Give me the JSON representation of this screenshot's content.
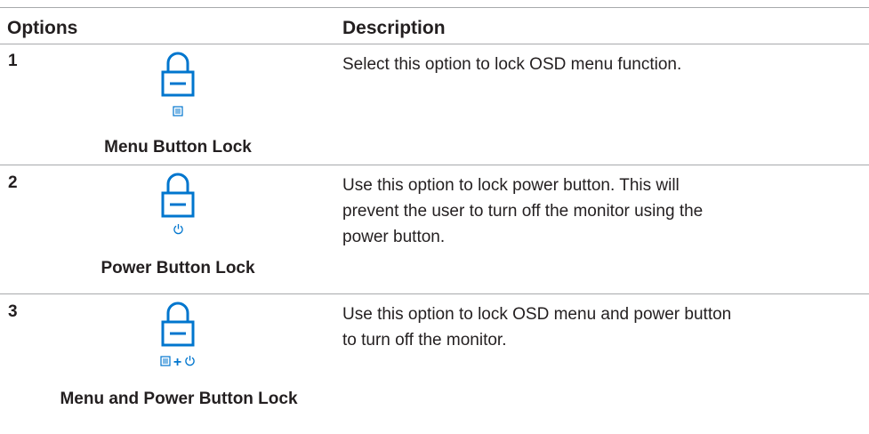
{
  "header": {
    "options": "Options",
    "description": "Description"
  },
  "rows": [
    {
      "number": "1",
      "label": "Menu Button Lock",
      "small_icons": [
        "menu-icon"
      ],
      "description": "Select this option to lock OSD menu function."
    },
    {
      "number": "2",
      "label": "Power Button Lock",
      "small_icons": [
        "power-icon"
      ],
      "description": "Use this option to lock power button. This will prevent the user to turn off the monitor using the power button."
    },
    {
      "number": "3",
      "label": "Menu and Power Button Lock",
      "small_icons": [
        "menu-icon",
        "plus",
        "power-icon"
      ],
      "plus": "+",
      "description": "Use this option to lock OSD menu and power button to turn off the monitor."
    }
  ],
  "colors": {
    "icon_blue": "#0076ce",
    "rule_gray": "#a7a9ac",
    "text": "#231f20"
  }
}
